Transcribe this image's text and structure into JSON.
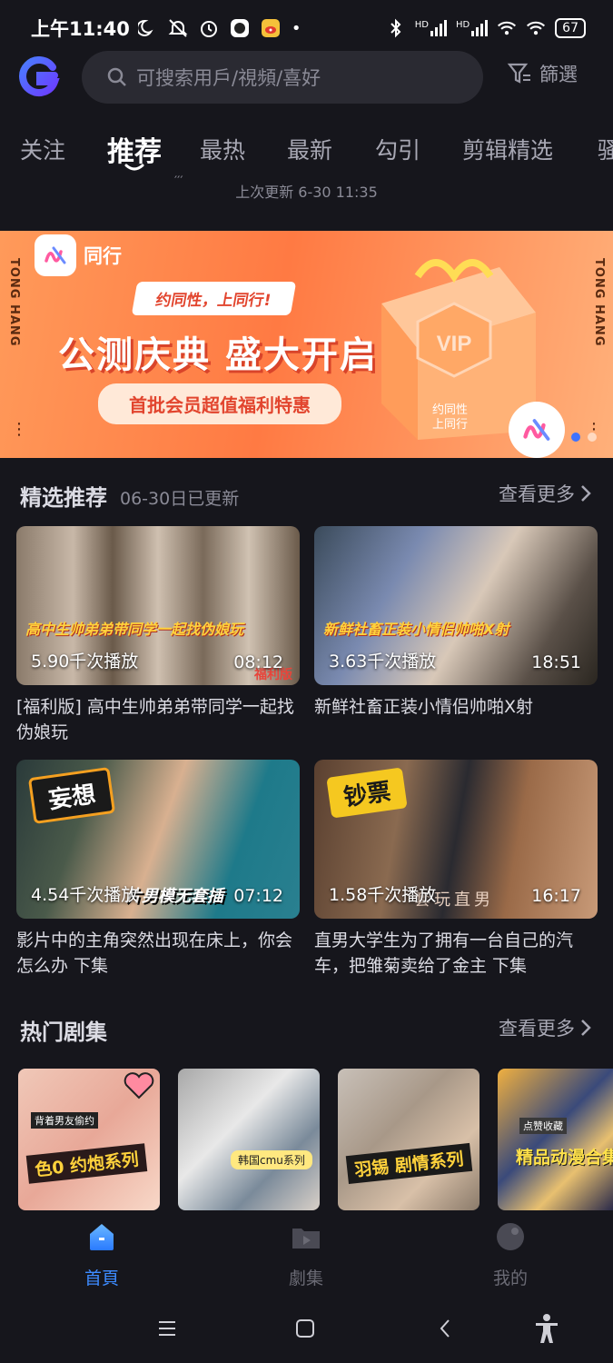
{
  "status_bar": {
    "time": "上午11:40",
    "battery": "67",
    "hd1": "HD",
    "hd2": "HD"
  },
  "header": {
    "search_placeholder": "可搜索用戶/視頻/喜好",
    "filter_label": "篩選"
  },
  "tabs": [
    {
      "label": "关注"
    },
    {
      "label": "推荐"
    },
    {
      "label": "最热"
    },
    {
      "label": "最新"
    },
    {
      "label": "勾引"
    },
    {
      "label": "剪辑精选"
    },
    {
      "label": "骚"
    }
  ],
  "refresh_note": "上次更新 6-30 11:35",
  "banner": {
    "app_name": "同行",
    "side_left": "TONG HANG",
    "side_right": "TONG HANG",
    "slogan": "约同性，上同行!",
    "headline": "公测庆典 盛大开启",
    "sub": "首批会员超值福利特惠",
    "vip": "VIP",
    "corner_line1": "约同性",
    "corner_line2": "上同行"
  },
  "featured": {
    "title": "精选推荐",
    "subtitle": "06-30日已更新",
    "see_more": "查看更多",
    "videos": [
      {
        "views": "5.90千次播放",
        "duration": "08:12",
        "caption": "高中生帅弟弟带同学一起找伪娘玩",
        "tag": "福利版",
        "title": "[福利版] 高中生帅弟弟带同学一起找伪娘玩"
      },
      {
        "views": "3.63千次播放",
        "duration": "18:51",
        "caption": "新鲜社畜正装小情侣帅啪X射",
        "title": "新鲜社畜正装小情侣帅啪X射"
      },
      {
        "views": "4.54千次播放",
        "duration": "07:12",
        "sticker": "妄想",
        "caption": "片男模无套插",
        "title": "影片中的主角突然出现在床上，你会怎么办 下集"
      },
      {
        "views": "1.58千次播放",
        "duration": "16:17",
        "sticker": "钞票",
        "caption": "套玩直男",
        "title": "直男大学生为了拥有一台自己的汽车，把雏菊卖给了金主 下集"
      }
    ]
  },
  "series": {
    "title": "热门剧集",
    "see_more": "查看更多",
    "items": [
      {
        "caption": "色0 约炮系列",
        "top_note": "背着男友偷约"
      },
      {
        "caption": "韩国cmu系列"
      },
      {
        "caption": "羽锡 剧情系列"
      },
      {
        "caption": "精品动漫合集",
        "top_note": "点赞收藏"
      }
    ]
  },
  "bottom_nav": [
    {
      "label": "首頁",
      "active": true
    },
    {
      "label": "劇集"
    },
    {
      "label": "我的"
    }
  ],
  "colors": {
    "accent": "#3d8bff",
    "background": "#16161c",
    "banner": "#ff7a43"
  }
}
